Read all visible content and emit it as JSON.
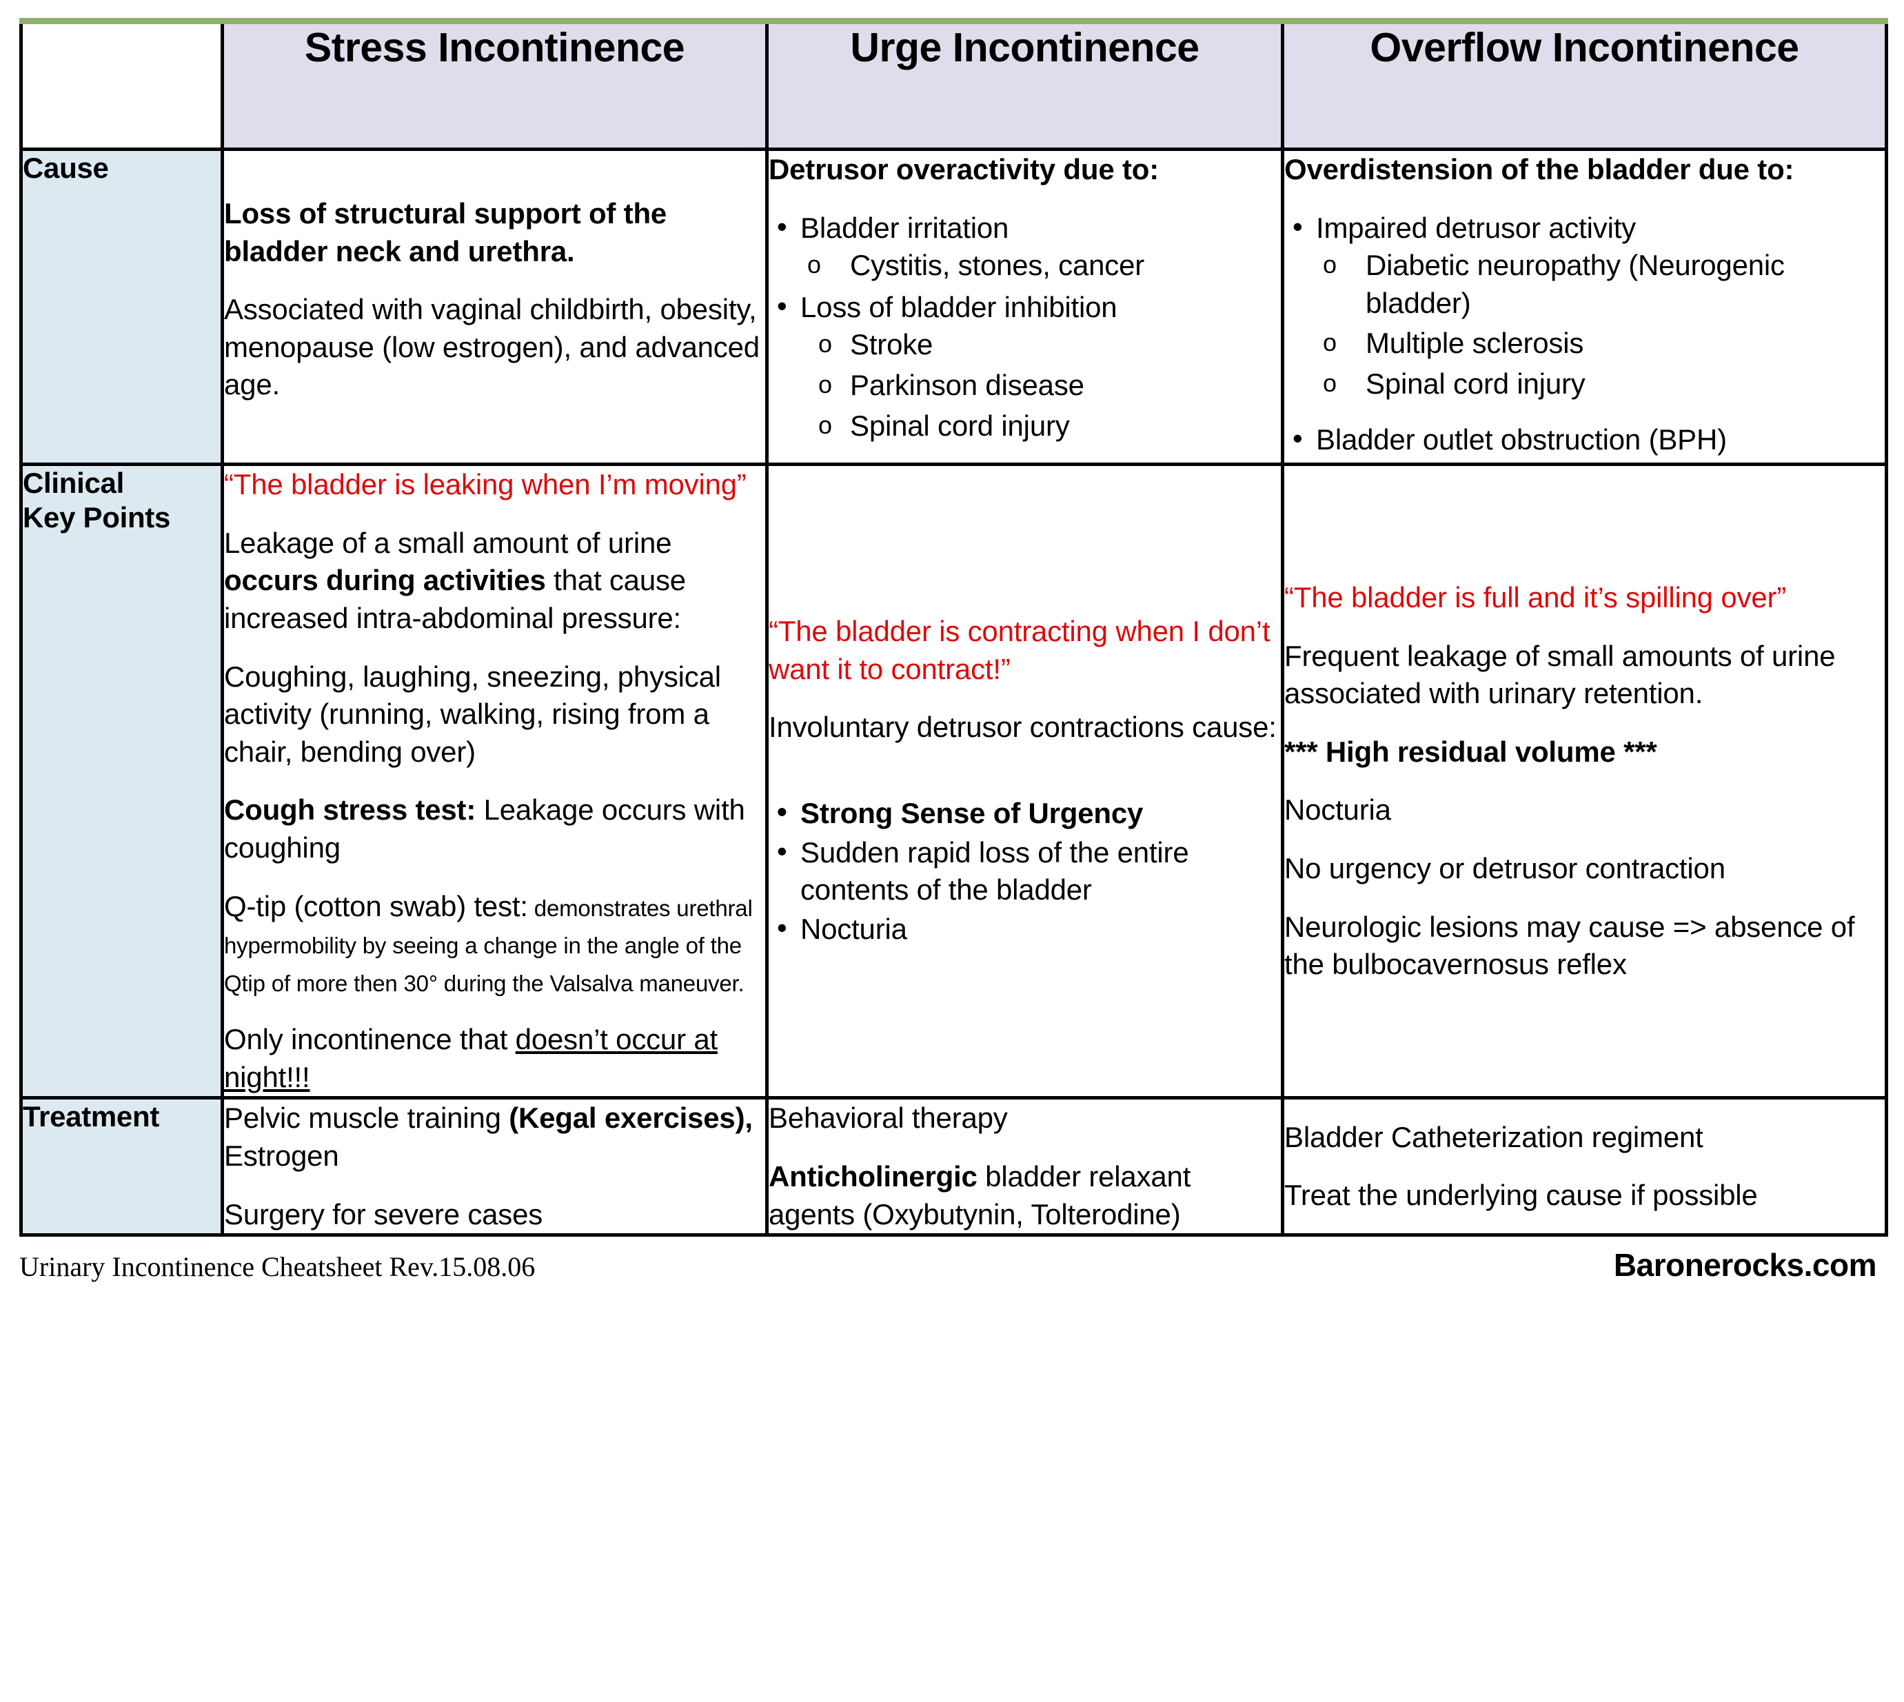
{
  "document": {
    "footer_left": "Urinary Incontinence Cheatsheet  Rev.15.08.06",
    "footer_right": "Baronerocks.com"
  },
  "colors": {
    "header_bg": "#e1dceb",
    "rowlabel_bg": "#dce9f1",
    "accent_green": "#90b06a",
    "quote_red": "#dd0a0a",
    "border": "#000000"
  },
  "table": {
    "corner_label": "",
    "columns": [
      {
        "id": "stress",
        "label": "Stress Incontinence"
      },
      {
        "id": "urge",
        "label": "Urge Incontinence"
      },
      {
        "id": "overflow",
        "label": "Overflow Incontinence"
      }
    ],
    "rows": [
      {
        "id": "cause",
        "label": "Cause"
      },
      {
        "id": "clinical",
        "label_line1": "Clinical",
        "label_line2": "Key Points"
      },
      {
        "id": "treatment",
        "label": "Treatment"
      }
    ]
  },
  "cells": {
    "cause": {
      "stress": {
        "p1_bold": "Loss of structural support of the bladder neck and urethra.",
        "p2": "Associated with vaginal childbirth, obesity, menopause (low estrogen), and advanced age."
      },
      "urge": {
        "heading": "Detrusor overactivity due to:",
        "bullet1": "Bladder irritation",
        "bullet1_sub1": "Cystitis, stones, cancer",
        "bullet2": "Loss of bladder inhibition",
        "bullet2_sub1": "Stroke",
        "bullet2_sub2": "Parkinson disease",
        "bullet2_sub3": "Spinal cord injury"
      },
      "overflow": {
        "heading": "Overdistension of the bladder due to:",
        "bullet1": "Impaired detrusor activity",
        "bullet1_sub1": "Diabetic neuropathy (Neurogenic bladder)",
        "bullet1_sub2": "Multiple sclerosis",
        "bullet1_sub3": "Spinal cord injury",
        "bullet2": "Bladder outlet obstruction (BPH)"
      }
    },
    "clinical": {
      "stress": {
        "quote": "“The bladder is leaking when I’m moving”",
        "p1_a": "Leakage of a small amount of urine ",
        "p1_bold": "occurs during activities",
        "p1_b": " that cause increased intra-abdominal pressure:",
        "p2": "Coughing, laughing, sneezing, physical activity (running, walking, rising from a chair, bending over)",
        "p3_bold": "Cough stress test:",
        "p3_rest": "  Leakage occurs with coughing",
        "p4_lead": "Q-tip (cotton swab) test:",
        "p4_small": " demonstrates urethral hypermobility by seeing a change in the angle of the Qtip of more then 30° during the Valsalva maneuver.",
        "p5_a": "Only incontinence that ",
        "p5_underline": "doesn’t occur at night!!!"
      },
      "urge": {
        "quote": "“The bladder is contracting when I don’t want it to contract!”",
        "p1": "Involuntary detrusor contractions cause:",
        "bullet1_bold": "Strong Sense of Urgency",
        "bullet2": "Sudden rapid loss of the entire contents of the bladder",
        "bullet3": "Nocturia"
      },
      "overflow": {
        "quote": "“The bladder is full and it’s spilling over”",
        "p1": "Frequent leakage of small amounts of urine associated with urinary retention.",
        "p2_bold": "*** High residual volume ***",
        "p3": "Nocturia",
        "p4": "No urgency or detrusor contraction",
        "p5": "Neurologic lesions may cause => absence of the bulbocavernosus reflex"
      }
    },
    "treatment": {
      "stress": {
        "p1_a": "Pelvic muscle training ",
        "p1_bold": "(Kegal exercises),",
        "p1_b": "  Estrogen",
        "p2": "Surgery for severe cases"
      },
      "urge": {
        "p1": "Behavioral therapy",
        "p2_bold": "Anticholinergic",
        "p2_rest": " bladder relaxant agents (Oxybutynin, Tolterodine)"
      },
      "overflow": {
        "p1": "Bladder Catheterization regiment",
        "p2": "Treat the underlying cause if possible"
      }
    }
  }
}
